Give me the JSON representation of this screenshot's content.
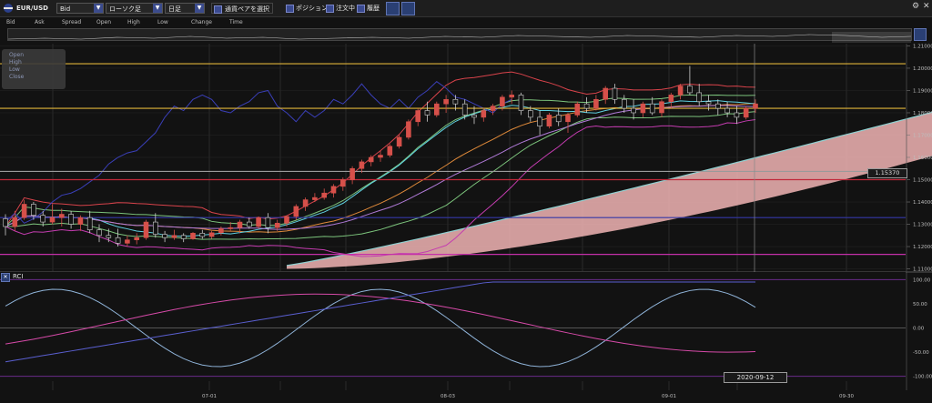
{
  "toolbar": {
    "symbol": "EUR/USD",
    "price_type": "Bid",
    "chart_type": "ローソク足",
    "period": "日足",
    "select_pair": "通貨ペアを選択",
    "position": "ポジション",
    "orders": "注文中",
    "history": "履歴"
  },
  "legend": [
    "Bid",
    "Ask",
    "Spread",
    "Open",
    "High",
    "Low",
    "Change",
    "Time"
  ],
  "ohlc_box": [
    "Open",
    "High",
    "Low",
    "Close"
  ],
  "price_label": "1.15370",
  "date_label": "2020-09-12",
  "rci_title": "RCI",
  "colors": {
    "bg": "#121212",
    "bull": "#d6504a",
    "bear": "#141414",
    "bull_outline": "#d6504a",
    "bear_outline": "#cfcfcf",
    "cloud": "#f2b5b5",
    "grid": "#3a3a3a"
  },
  "chart_data": {
    "type": "candlestick",
    "x_ticks": [
      "07-01",
      "08-03",
      "09-01",
      "09-30"
    ],
    "y_ticks": [
      "1.21000",
      "1.20000",
      "1.19000",
      "1.18000",
      "1.17000",
      "1.16000",
      "1.15000",
      "1.14000",
      "1.13000",
      "1.12000",
      "1.11000"
    ],
    "ylim": [
      1.109,
      1.211
    ],
    "rci_ticks": [
      "100.00",
      "50.00",
      "0.00",
      "-50.00",
      "-100.00"
    ],
    "rci_ylim": [
      -110,
      110
    ],
    "candles": [
      [
        1.1325,
        1.1345,
        1.125,
        1.129
      ],
      [
        1.129,
        1.136,
        1.127,
        1.133
      ],
      [
        1.133,
        1.141,
        1.132,
        1.139
      ],
      [
        1.139,
        1.14,
        1.132,
        1.134
      ],
      [
        1.134,
        1.136,
        1.129,
        1.131
      ],
      [
        1.131,
        1.139,
        1.13,
        1.133
      ],
      [
        1.133,
        1.137,
        1.129,
        1.1345
      ],
      [
        1.1345,
        1.136,
        1.128,
        1.13
      ],
      [
        1.13,
        1.134,
        1.127,
        1.133
      ],
      [
        1.133,
        1.136,
        1.126,
        1.1275
      ],
      [
        1.1275,
        1.13,
        1.122,
        1.125
      ],
      [
        1.125,
        1.128,
        1.122,
        1.124
      ],
      [
        1.124,
        1.128,
        1.12,
        1.1215
      ],
      [
        1.1215,
        1.125,
        1.12,
        1.123
      ],
      [
        1.123,
        1.126,
        1.121,
        1.124
      ],
      [
        1.124,
        1.132,
        1.123,
        1.131
      ],
      [
        1.131,
        1.135,
        1.124,
        1.1255
      ],
      [
        1.1255,
        1.127,
        1.122,
        1.124
      ],
      [
        1.124,
        1.1275,
        1.123,
        1.125
      ],
      [
        1.125,
        1.126,
        1.122,
        1.1235
      ],
      [
        1.1235,
        1.1265,
        1.123,
        1.126
      ],
      [
        1.126,
        1.1275,
        1.1235,
        1.1245
      ],
      [
        1.1245,
        1.127,
        1.1235,
        1.1262
      ],
      [
        1.1262,
        1.129,
        1.125,
        1.128
      ],
      [
        1.128,
        1.131,
        1.127,
        1.1285
      ],
      [
        1.1285,
        1.132,
        1.126,
        1.131
      ],
      [
        1.131,
        1.133,
        1.128,
        1.129
      ],
      [
        1.129,
        1.1335,
        1.128,
        1.133
      ],
      [
        1.133,
        1.135,
        1.126,
        1.1285
      ],
      [
        1.1285,
        1.132,
        1.127,
        1.1305
      ],
      [
        1.1305,
        1.134,
        1.129,
        1.1335
      ],
      [
        1.1335,
        1.139,
        1.132,
        1.138
      ],
      [
        1.138,
        1.142,
        1.136,
        1.141
      ],
      [
        1.141,
        1.144,
        1.14,
        1.142
      ],
      [
        1.142,
        1.146,
        1.141,
        1.144
      ],
      [
        1.144,
        1.148,
        1.142,
        1.147
      ],
      [
        1.147,
        1.151,
        1.145,
        1.15
      ],
      [
        1.15,
        1.156,
        1.148,
        1.155
      ],
      [
        1.155,
        1.159,
        1.153,
        1.158
      ],
      [
        1.158,
        1.161,
        1.156,
        1.16
      ],
      [
        1.16,
        1.163,
        1.158,
        1.161
      ],
      [
        1.161,
        1.166,
        1.16,
        1.165
      ],
      [
        1.165,
        1.17,
        1.164,
        1.169
      ],
      [
        1.169,
        1.177,
        1.168,
        1.176
      ],
      [
        1.176,
        1.182,
        1.174,
        1.181
      ],
      [
        1.181,
        1.185,
        1.176,
        1.179
      ],
      [
        1.179,
        1.185,
        1.178,
        1.184
      ],
      [
        1.184,
        1.188,
        1.18,
        1.186
      ],
      [
        1.186,
        1.188,
        1.181,
        1.184
      ],
      [
        1.184,
        1.186,
        1.177,
        1.179
      ],
      [
        1.179,
        1.183,
        1.175,
        1.178
      ],
      [
        1.178,
        1.182,
        1.176,
        1.181
      ],
      [
        1.181,
        1.184,
        1.179,
        1.183
      ],
      [
        1.183,
        1.188,
        1.181,
        1.187
      ],
      [
        1.187,
        1.19,
        1.184,
        1.188
      ],
      [
        1.188,
        1.189,
        1.179,
        1.181
      ],
      [
        1.181,
        1.183,
        1.176,
        1.178
      ],
      [
        1.178,
        1.181,
        1.17,
        1.174
      ],
      [
        1.174,
        1.18,
        1.173,
        1.179
      ],
      [
        1.179,
        1.182,
        1.174,
        1.176
      ],
      [
        1.176,
        1.18,
        1.171,
        1.179
      ],
      [
        1.179,
        1.185,
        1.178,
        1.184
      ],
      [
        1.184,
        1.187,
        1.18,
        1.182
      ],
      [
        1.182,
        1.188,
        1.181,
        1.186
      ],
      [
        1.186,
        1.192,
        1.184,
        1.191
      ],
      [
        1.191,
        1.193,
        1.184,
        1.186
      ],
      [
        1.186,
        1.188,
        1.18,
        1.182
      ],
      [
        1.182,
        1.186,
        1.177,
        1.18
      ],
      [
        1.18,
        1.185,
        1.178,
        1.184
      ],
      [
        1.184,
        1.187,
        1.179,
        1.18
      ],
      [
        1.18,
        1.186,
        1.178,
        1.185
      ],
      [
        1.185,
        1.189,
        1.182,
        1.188
      ],
      [
        1.188,
        1.193,
        1.186,
        1.192
      ],
      [
        1.192,
        1.201,
        1.188,
        1.189
      ],
      [
        1.189,
        1.193,
        1.183,
        1.185
      ],
      [
        1.185,
        1.188,
        1.181,
        1.184
      ],
      [
        1.184,
        1.186,
        1.179,
        1.182
      ],
      [
        1.182,
        1.185,
        1.178,
        1.18
      ],
      [
        1.18,
        1.183,
        1.175,
        1.178
      ],
      [
        1.178,
        1.183,
        1.177,
        1.182
      ],
      [
        1.182,
        1.186,
        1.18,
        1.184
      ]
    ],
    "horizontal_lines": [
      {
        "value": 1.202,
        "color": "#e0b43a"
      },
      {
        "value": 1.182,
        "color": "#e0b43a"
      },
      {
        "value": 1.1537,
        "color": "#9a9a9a"
      },
      {
        "value": 1.15,
        "color": "#c0283a"
      },
      {
        "value": 1.133,
        "color": "#3438a8"
      },
      {
        "value": 1.1165,
        "color": "#c42fa8"
      }
    ]
  }
}
